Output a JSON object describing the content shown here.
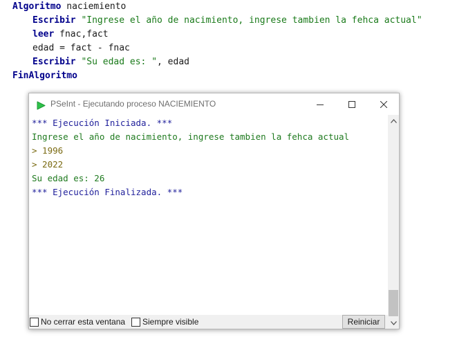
{
  "code": {
    "line1": {
      "keyword": "Algoritmo",
      "rest": " naciemiento"
    },
    "line2": {
      "keyword": "Escribir",
      "string": " \"Ingrese el año de nacimiento, ingrese tambien la fehca actual\""
    },
    "line3": {
      "keyword": "leer",
      "rest": " fnac,fact"
    },
    "line4": {
      "text": "edad = fact - fnac"
    },
    "line5": {
      "keyword": "Escribir",
      "string": " \"Su edad es: \"",
      "rest": ", edad"
    },
    "line6": {
      "keyword": "FinAlgoritmo"
    }
  },
  "window": {
    "title": "PSeInt - Ejecutando proceso NACIEMIENTO",
    "icon": "pseint-green-arrow-icon"
  },
  "console": {
    "lines": [
      "*** Ejecución Iniciada. ***",
      "Ingrese el año de nacimiento, ingrese tambien la fehca actual",
      "> 1996",
      "> 2022",
      "Su edad es: 26",
      "*** Ejecución Finalizada. ***"
    ]
  },
  "bottom": {
    "keep_open_label": "No cerrar esta ventana",
    "always_visible_label": "Siempre visible",
    "restart_label": "Reiniciar"
  },
  "colors": {
    "keyword": "#00008b",
    "string": "#1a7a1a",
    "console_blue": "#1e1e9a",
    "console_green": "#1f7a1f",
    "console_input": "#7a6a12",
    "icon_green": "#2ec24a"
  }
}
